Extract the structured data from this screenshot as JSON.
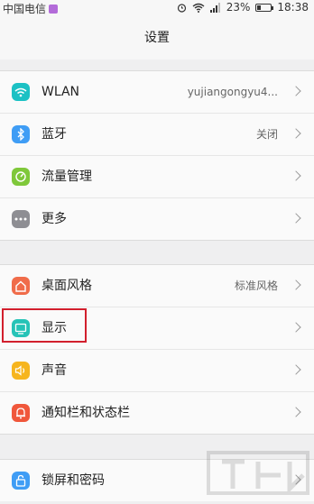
{
  "statusbar": {
    "carrier": "中国电信",
    "battery": "23%",
    "time": "18:38",
    "icons": [
      "alarm-icon",
      "wifi-icon",
      "signal-icon",
      "battery-icon"
    ]
  },
  "header": {
    "title": "设置"
  },
  "groups": [
    {
      "items": [
        {
          "label": "WLAN",
          "value": "yujiangongyu4...",
          "icon": "wifi-icon",
          "color": "#1cc1c4"
        },
        {
          "label": "蓝牙",
          "value": "关闭",
          "icon": "bluetooth-icon",
          "color": "#3f9df5"
        },
        {
          "label": "流量管理",
          "value": "",
          "icon": "data-usage-icon",
          "color": "#7fc83a"
        },
        {
          "label": "更多",
          "value": "",
          "icon": "more-icon",
          "color": "#8e8e93"
        }
      ]
    },
    {
      "items": [
        {
          "label": "桌面风格",
          "value": "标准风格",
          "icon": "home-icon",
          "color": "#f06c4a"
        },
        {
          "label": "显示",
          "value": "",
          "icon": "display-icon",
          "color": "#27c3b7"
        },
        {
          "label": "声音",
          "value": "",
          "icon": "sound-icon",
          "color": "#f6b51e"
        },
        {
          "label": "通知栏和状态栏",
          "value": "",
          "icon": "notification-icon",
          "color": "#f0573b"
        }
      ]
    },
    {
      "items": [
        {
          "label": "锁屏和密码",
          "value": "",
          "icon": "lock-icon",
          "color": "#3f9df5"
        }
      ]
    }
  ],
  "colors": {
    "highlight": "#d21f2d",
    "background": "#efeff0"
  }
}
